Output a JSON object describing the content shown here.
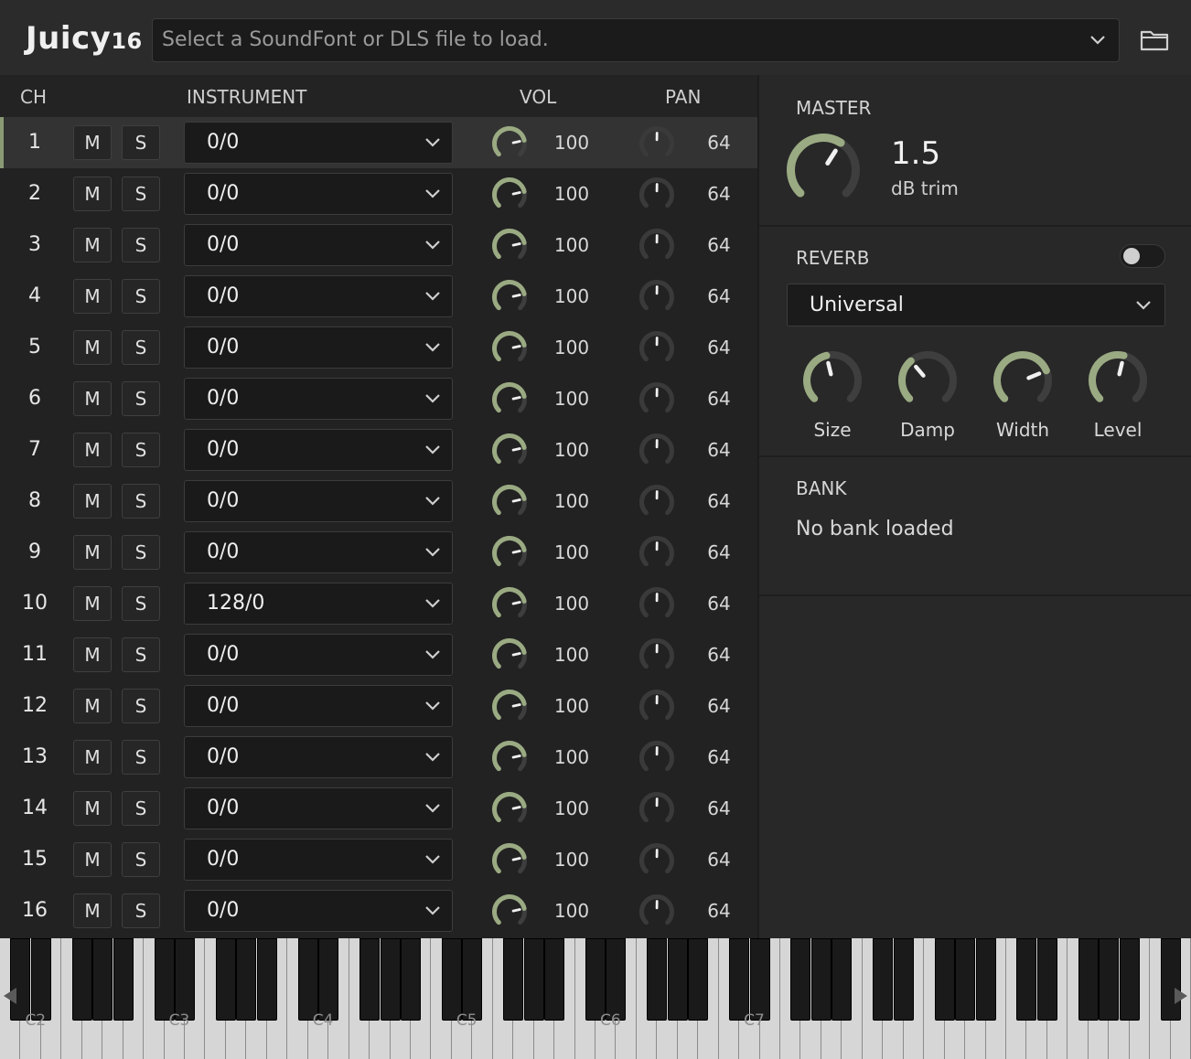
{
  "app": {
    "logo_big": "Juicy",
    "logo_small": "16"
  },
  "header": {
    "file_placeholder": "Select a SoundFont or DLS file to load."
  },
  "columns": {
    "ch": "CH",
    "instrument": "INSTRUMENT",
    "vol": "VOL",
    "pan": "PAN"
  },
  "mute_label": "M",
  "solo_label": "S",
  "selected_channel": 1,
  "channels": [
    {
      "ch": "1",
      "instrument": "0/0",
      "vol": "100",
      "pan": "64"
    },
    {
      "ch": "2",
      "instrument": "0/0",
      "vol": "100",
      "pan": "64"
    },
    {
      "ch": "3",
      "instrument": "0/0",
      "vol": "100",
      "pan": "64"
    },
    {
      "ch": "4",
      "instrument": "0/0",
      "vol": "100",
      "pan": "64"
    },
    {
      "ch": "5",
      "instrument": "0/0",
      "vol": "100",
      "pan": "64"
    },
    {
      "ch": "6",
      "instrument": "0/0",
      "vol": "100",
      "pan": "64"
    },
    {
      "ch": "7",
      "instrument": "0/0",
      "vol": "100",
      "pan": "64"
    },
    {
      "ch": "8",
      "instrument": "0/0",
      "vol": "100",
      "pan": "64"
    },
    {
      "ch": "9",
      "instrument": "0/0",
      "vol": "100",
      "pan": "64"
    },
    {
      "ch": "10",
      "instrument": "128/0",
      "vol": "100",
      "pan": "64"
    },
    {
      "ch": "11",
      "instrument": "0/0",
      "vol": "100",
      "pan": "64"
    },
    {
      "ch": "12",
      "instrument": "0/0",
      "vol": "100",
      "pan": "64"
    },
    {
      "ch": "13",
      "instrument": "0/0",
      "vol": "100",
      "pan": "64"
    },
    {
      "ch": "14",
      "instrument": "0/0",
      "vol": "100",
      "pan": "64"
    },
    {
      "ch": "15",
      "instrument": "0/0",
      "vol": "100",
      "pan": "64"
    },
    {
      "ch": "16",
      "instrument": "0/0",
      "vol": "100",
      "pan": "64"
    }
  ],
  "master": {
    "title": "MASTER",
    "value": "1.5",
    "unit": "dB trim",
    "level": 0.62
  },
  "reverb": {
    "title": "REVERB",
    "enabled": false,
    "preset": "Universal",
    "knobs": [
      {
        "label": "Size",
        "level": 0.45
      },
      {
        "label": "Damp",
        "level": 0.35
      },
      {
        "label": "Width",
        "level": 0.75
      },
      {
        "label": "Level",
        "level": 0.55
      }
    ]
  },
  "bank": {
    "title": "BANK",
    "status": "No bank loaded"
  },
  "keyboard": {
    "octave_labels": [
      "C2",
      "C3",
      "C4",
      "C5",
      "C6",
      "C7"
    ]
  },
  "colors": {
    "accent": "#9aaa82",
    "knob_track": "#3e3e3e",
    "pan_track": "#3a3a3a",
    "background": "#222222",
    "panel": "#282828"
  },
  "icons": {
    "dropdown": "chevron-down-icon",
    "folder": "folder-icon",
    "keyboard_left": "arrow-left-icon",
    "keyboard_right": "arrow-right-icon"
  }
}
